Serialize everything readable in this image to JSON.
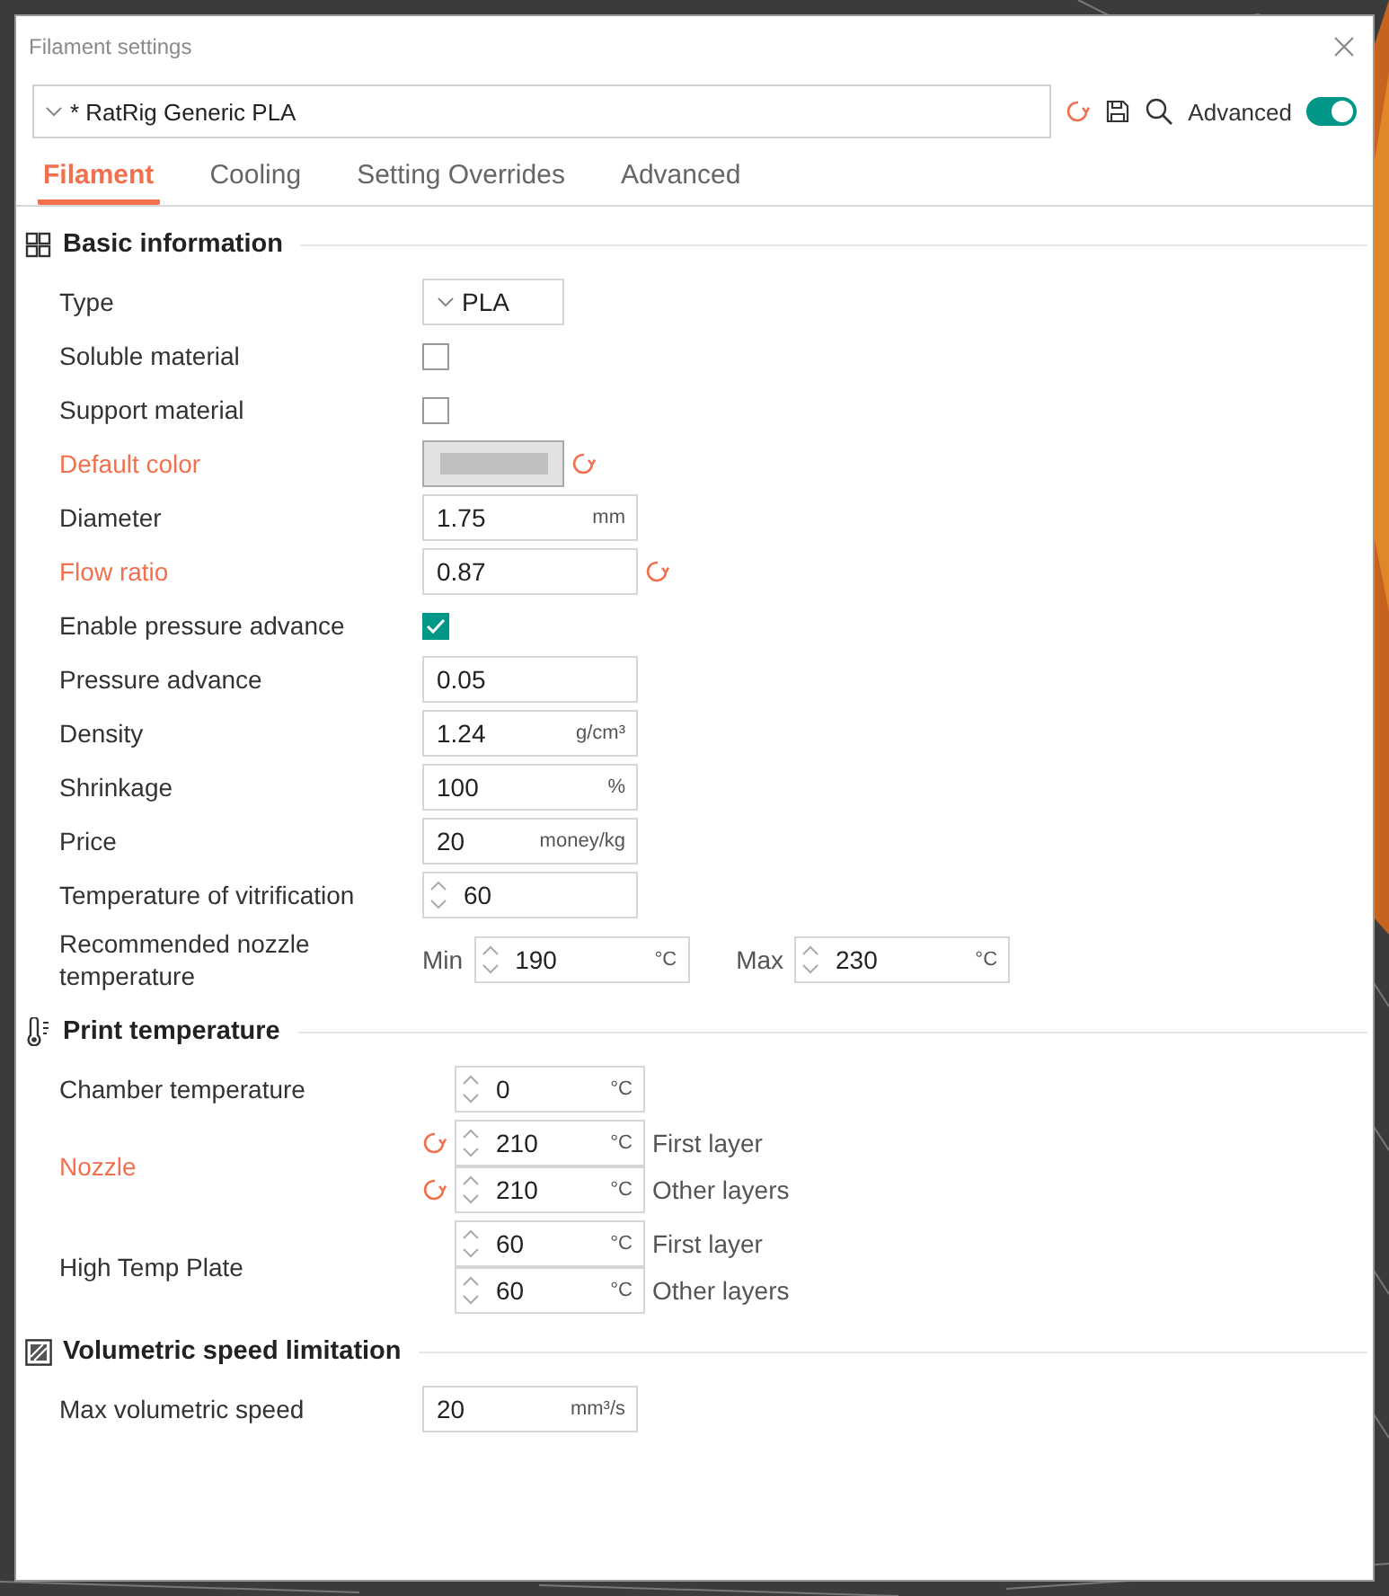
{
  "window": {
    "title": "Filament settings"
  },
  "preset": {
    "value": "* RatRig Generic PLA",
    "modified": true
  },
  "advanced": {
    "label": "Advanced",
    "on": true
  },
  "tabs": [
    {
      "label": "Filament",
      "selected": true
    },
    {
      "label": "Cooling",
      "selected": false
    },
    {
      "label": "Setting Overrides",
      "selected": false
    },
    {
      "label": "Advanced",
      "selected": false
    }
  ],
  "sections": [
    {
      "title": "Basic information",
      "kind": "grid",
      "rows": [
        {
          "kind": "dropdown",
          "label": "Type",
          "modified": false,
          "value": "PLA"
        },
        {
          "kind": "checkbox",
          "label": "Soluble material",
          "modified": false,
          "checked": false
        },
        {
          "kind": "checkbox",
          "label": "Support material",
          "modified": false,
          "checked": false
        },
        {
          "kind": "color",
          "label": "Default color",
          "modified": true,
          "color": "#c0c0c0"
        },
        {
          "kind": "input",
          "label": "Diameter",
          "modified": false,
          "value": "1.75",
          "unit": "mm"
        },
        {
          "kind": "input",
          "label": "Flow ratio",
          "modified": true,
          "value": "0.87"
        },
        {
          "kind": "checkbox",
          "label": "Enable pressure advance",
          "modified": false,
          "checked": true
        },
        {
          "kind": "input",
          "label": "Pressure advance",
          "modified": false,
          "value": "0.05"
        },
        {
          "kind": "input",
          "label": "Density",
          "modified": false,
          "value": "1.24",
          "unit": "g/cm³"
        },
        {
          "kind": "input",
          "label": "Shrinkage",
          "modified": false,
          "value": "100",
          "unit": "%"
        },
        {
          "kind": "input",
          "label": "Price",
          "modified": false,
          "value": "20",
          "unit": "money/kg"
        },
        {
          "kind": "spin",
          "label": "Temperature of vitrification",
          "modified": false,
          "value": "60"
        },
        {
          "kind": "range",
          "label": "Recommended nozzle temperature",
          "modified": false,
          "min_label": "Min",
          "min": "190",
          "min_unit": "°C",
          "max_label": "Max",
          "max": "230",
          "max_unit": "°C"
        }
      ]
    },
    {
      "title": "Print temperature",
      "kind": "thermometer",
      "rows": [
        {
          "kind": "temp",
          "label": "Chamber temperature",
          "modified": false,
          "value": "0",
          "unit": "°C"
        },
        {
          "kind": "layers",
          "label": "Nozzle",
          "modified": true,
          "items": [
            {
              "value": "210",
              "unit": "°C",
              "note": "First layer"
            },
            {
              "value": "210",
              "unit": "°C",
              "note": "Other layers"
            }
          ]
        },
        {
          "kind": "layers",
          "label": "High Temp Plate",
          "modified": false,
          "items": [
            {
              "value": "60",
              "unit": "°C",
              "note": "First layer"
            },
            {
              "value": "60",
              "unit": "°C",
              "note": "Other layers"
            }
          ]
        }
      ]
    },
    {
      "title": "Volumetric speed limitation",
      "kind": "hatch",
      "rows": [
        {
          "kind": "input",
          "label": "Max volumetric speed",
          "modified": false,
          "value": "20",
          "unit": "mm³/s"
        }
      ]
    }
  ]
}
